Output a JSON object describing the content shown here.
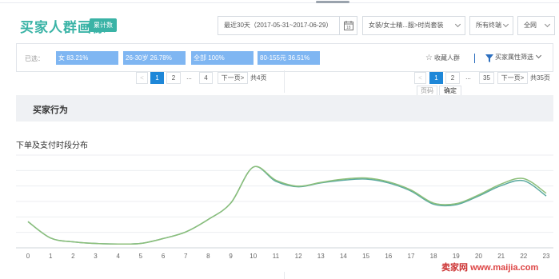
{
  "header": {
    "title": "买家人群画像",
    "badge": "累计数",
    "date_range": "最近30天（2017-05-31~2017-06-29）",
    "category": "女装/女士精...服>时尚套装",
    "terminal": "所有终端",
    "network": "全网"
  },
  "filters": {
    "selected_label": "已选：",
    "chips": [
      "女 83.21%",
      "26-30岁 26.78%",
      "全部 100%",
      "80-155元 36.51%"
    ],
    "collect_label": "收藏人群",
    "attr_filter_label": "买家属性筛选"
  },
  "pager_left": {
    "prev": "<",
    "pages": [
      "1",
      "2",
      "...",
      "4"
    ],
    "next": "下一页>",
    "total": "共4页"
  },
  "pager_right": {
    "prev": "<",
    "pages": [
      "1",
      "2",
      "...",
      "35"
    ],
    "next": "下一页>",
    "total": "共35页",
    "page_input_label": "页码",
    "confirm_label": "确定"
  },
  "section": {
    "title": "买家行为"
  },
  "chart_title": "下单及支付时段分布",
  "colors": {
    "accent": "#3ab3a6",
    "chip": "#7fb6f2",
    "active_page": "#1e87d8",
    "line_a": "#5aa9a0",
    "line_b": "#8cbf7a"
  },
  "chart_data": {
    "type": "line",
    "x": [
      0,
      1,
      2,
      3,
      4,
      5,
      6,
      7,
      8,
      9,
      10,
      11,
      12,
      13,
      14,
      15,
      16,
      17,
      18,
      19,
      20,
      21,
      22,
      23
    ],
    "series": [
      {
        "values": [
          48,
          18,
          11,
          8,
          7,
          8,
          17,
          29,
          52,
          82,
          148,
          122,
          112,
          119,
          124,
          126,
          119,
          104,
          80,
          79,
          95,
          114,
          123,
          95
        ]
      },
      {
        "values": [
          48,
          18,
          11,
          8,
          7,
          8,
          17,
          29,
          52,
          82,
          148,
          124,
          113,
          120,
          126,
          128,
          121,
          106,
          82,
          81,
          97,
          117,
          127,
          100
        ]
      }
    ],
    "xlabel": "",
    "ylabel": "",
    "ylim": [
      0,
      170
    ],
    "grid": true,
    "legend": "none"
  },
  "watermark": {
    "brand": "卖家网",
    "url": "www.maijia.com"
  }
}
